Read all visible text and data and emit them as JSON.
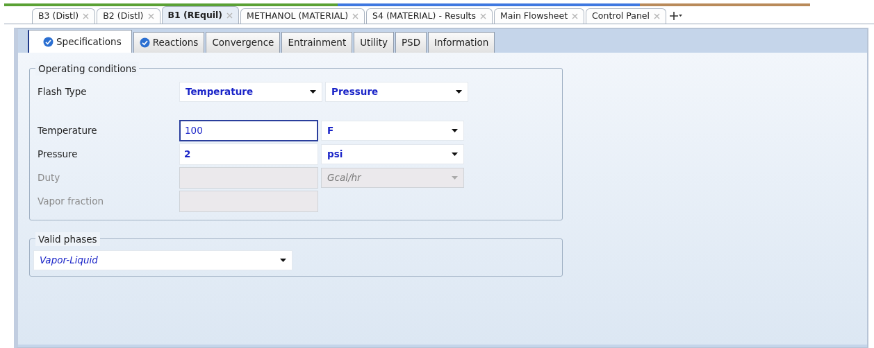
{
  "document_tabs": [
    {
      "label": "B3 (Distl)",
      "selected": false
    },
    {
      "label": "B2 (Distl)",
      "selected": false
    },
    {
      "label": "B1 (REquil)",
      "selected": true
    },
    {
      "label": "METHANOL (MATERIAL)",
      "selected": false
    },
    {
      "label": "S4 (MATERIAL) - Results",
      "selected": false
    },
    {
      "label": "Main Flowsheet",
      "selected": false
    },
    {
      "label": "Control Panel",
      "selected": false
    }
  ],
  "form_tabs": [
    {
      "label": "Specifications",
      "selected": true,
      "complete": true
    },
    {
      "label": "Reactions",
      "selected": false,
      "complete": true
    },
    {
      "label": "Convergence",
      "selected": false,
      "complete": false
    },
    {
      "label": "Entrainment",
      "selected": false,
      "complete": false
    },
    {
      "label": "Utility",
      "selected": false,
      "complete": false
    },
    {
      "label": "PSD",
      "selected": false,
      "complete": false
    },
    {
      "label": "Information",
      "selected": false,
      "complete": false
    }
  ],
  "operating_conditions": {
    "title": "Operating conditions",
    "flash_type": {
      "label": "Flash Type",
      "values": [
        "Temperature",
        "Pressure"
      ]
    },
    "rows": [
      {
        "label": "Temperature",
        "value": "100",
        "unit": "F",
        "disabled": false,
        "focused": true
      },
      {
        "label": "Pressure",
        "value": "2",
        "unit": "psi",
        "disabled": false,
        "focused": false
      },
      {
        "label": "Duty",
        "unit": "Gcal/hr",
        "disabled": true,
        "focused": false
      },
      {
        "label": "Vapor fraction",
        "disabled": true,
        "focused": false
      }
    ]
  },
  "valid_phases": {
    "title": "Valid phases",
    "value": "Vapor-Liquid"
  }
}
